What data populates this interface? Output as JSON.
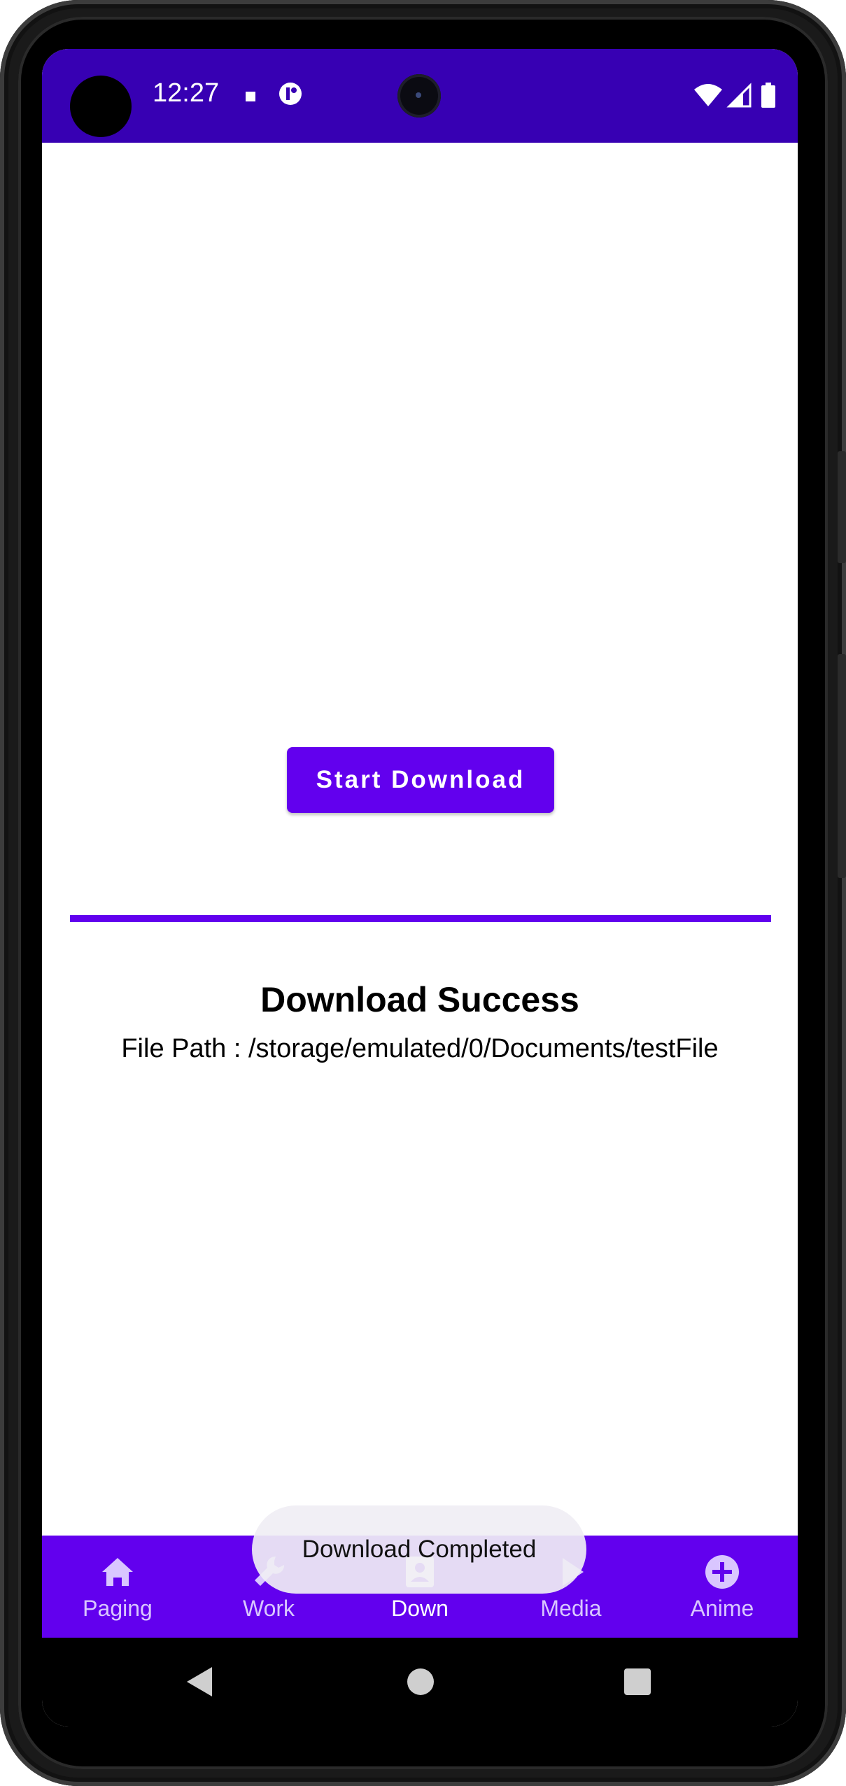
{
  "status_bar": {
    "time": "12:27",
    "background": "#3700b3",
    "icons": [
      "notification-square-icon",
      "app-g-icon",
      "wifi-icon",
      "signal-icon",
      "battery-icon"
    ]
  },
  "main": {
    "start_button_label": "Start Download",
    "progress_fraction": 1.0,
    "result_title": "Download Success",
    "result_path": "File Path : /storage/emulated/0/Documents/testFile"
  },
  "bottom_nav": {
    "background": "#6200ee",
    "items": [
      {
        "label": "Paging",
        "icon": "home-icon"
      },
      {
        "label": "Work",
        "icon": "wrench-icon"
      },
      {
        "label": "Down",
        "icon": "contact-icon"
      },
      {
        "label": "Media",
        "icon": "play-icon"
      },
      {
        "label": "Anime",
        "icon": "add-circle-icon"
      }
    ],
    "active_index": 2
  },
  "toast": {
    "message": "Download Completed"
  },
  "colors": {
    "accent": "#6200ee",
    "status": "#3700b3"
  }
}
